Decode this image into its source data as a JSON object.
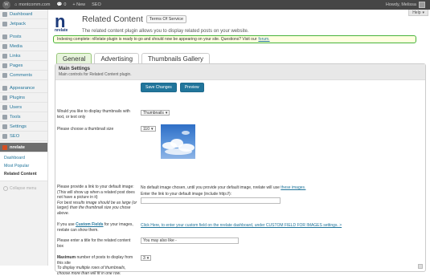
{
  "adminbar": {
    "site": "montcomm.com",
    "comments": "0",
    "new_label": "+ New",
    "seo": "SEO",
    "greeting": "Howdy, Melissa"
  },
  "sidebar": {
    "items": [
      {
        "label": "Dashboard"
      },
      {
        "label": "Jetpack"
      },
      {
        "label": "Posts"
      },
      {
        "label": "Media"
      },
      {
        "label": "Links"
      },
      {
        "label": "Pages"
      },
      {
        "label": "Comments"
      },
      {
        "label": "Appearance"
      },
      {
        "label": "Plugins"
      },
      {
        "label": "Users"
      },
      {
        "label": "Tools"
      },
      {
        "label": "Settings"
      },
      {
        "label": "SEO"
      }
    ],
    "active": "nrelate",
    "submenu": [
      "Dashboard",
      "Most Popular",
      "Related Content"
    ],
    "collapse": "Collapse menu"
  },
  "header": {
    "help": "Help",
    "logo_text": "nrelate",
    "title": "Related Content",
    "tos": "Terms Of Service",
    "subtitle": "The related content plugin allows you to display related posts on your website.",
    "notice": "Indexing complete: nRelate plugin is ready to go and should now be appearing on your site. Questions? Visit our",
    "notice_link": "forum."
  },
  "tabs": [
    "General",
    "Advertising",
    "Thumbnails Gallery"
  ],
  "panel": {
    "title": "Main Settings",
    "desc": "Main controls for Related Content plugin.",
    "save": "Save Changes",
    "preview": "Preview",
    "q_display": "Would you like to display thumbnails with text, or text only",
    "display_value": "Thumbnails",
    "q_size": "Please choose a thumbnail size",
    "size_value": "110",
    "q_default_1": "Please provide a link to your default image: (This will show up when a related post does not have a picture in it)",
    "q_default_2": "For best results image should be as large (or larger) than the thumbnail size you chose above.",
    "default_note": "No default image chosen, until you provide your default image, nrelate will use",
    "default_note_link": "these images.",
    "default_input_label": "Enter the link to your default image (include http://):",
    "q_custom_pre": "If you use",
    "q_custom_bold": "Custom Fields",
    "q_custom_post": "for your images, nrelate can show them.",
    "custom_link": "Click Here, to enter your custom field on the nrelate dashboard, under CUSTOM FIELD FOR IMAGES settings. >",
    "q_title": "Please enter a title for the related content box",
    "title_value": "You may also like -",
    "q_max_bold": "Maximum",
    "q_max": "number of posts to display from this site",
    "q_max_2": "To display multiple rows of thumbnails, choose more than will fit in one row.",
    "max_value": "3"
  }
}
